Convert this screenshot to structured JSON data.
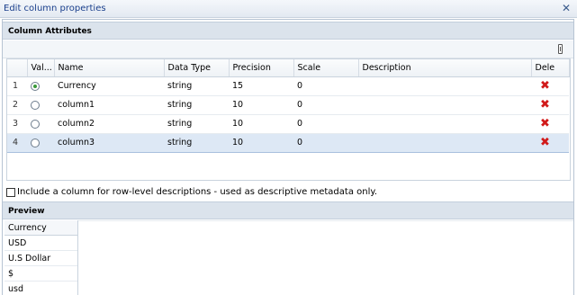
{
  "dialog": {
    "title": "Edit column properties",
    "close_icon": "close-icon"
  },
  "section": {
    "title": "Column Attributes",
    "more_icon": "more-icon"
  },
  "grid": {
    "headers": [
      "Val...",
      "Name",
      "Data Type",
      "Precision",
      "Scale",
      "Description",
      "Dele"
    ],
    "rows": [
      {
        "num": "1",
        "valid": true,
        "name": "Currency",
        "type": "string",
        "precision": "15",
        "scale": "0",
        "description": ""
      },
      {
        "num": "2",
        "valid": false,
        "name": "column1",
        "type": "string",
        "precision": "10",
        "scale": "0",
        "description": ""
      },
      {
        "num": "3",
        "valid": false,
        "name": "column2",
        "type": "string",
        "precision": "10",
        "scale": "0",
        "description": ""
      },
      {
        "num": "4",
        "valid": false,
        "name": "column3",
        "type": "string",
        "precision": "10",
        "scale": "0",
        "description": ""
      }
    ],
    "selected_row": "4",
    "delete_icon": "delete-icon",
    "delete_color": "#d11a1a",
    "valid_on_color": "#3a9a3a"
  },
  "options": {
    "row_desc_label": "Include a column for row-level descriptions - used as descriptive metadata only.",
    "row_desc_checked": false
  },
  "preview": {
    "title": "Preview",
    "column_header": "Currency",
    "values": [
      "USD",
      "U.S Dollar",
      "$",
      "usd"
    ]
  },
  "colors": {
    "title_text": "#1a3f8c",
    "section_bg": "#dbe3ec",
    "selected_row_bg": "#dde8f5"
  }
}
